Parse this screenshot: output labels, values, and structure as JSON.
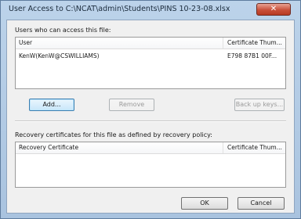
{
  "window": {
    "title": "User Access to C:\\NCAT\\admin\\Students\\PINS 10-23-08.xlsx",
    "close_glyph": "✕"
  },
  "users_section": {
    "label": "Users who can access this file:",
    "columns": [
      "User",
      "Certificate Thum..."
    ],
    "rows": [
      {
        "user": "KenW(KenW@CSWILLIAMS)",
        "thumb": "E798 87B1 00F..."
      }
    ]
  },
  "buttons": {
    "add": "Add...",
    "remove": "Remove",
    "backup_keys": "Back up keys...",
    "ok": "OK",
    "cancel": "Cancel"
  },
  "recovery_section": {
    "label": "Recovery certificates for this file as defined by recovery policy:",
    "columns": [
      "Recovery Certificate",
      "Certificate Thum..."
    ]
  }
}
